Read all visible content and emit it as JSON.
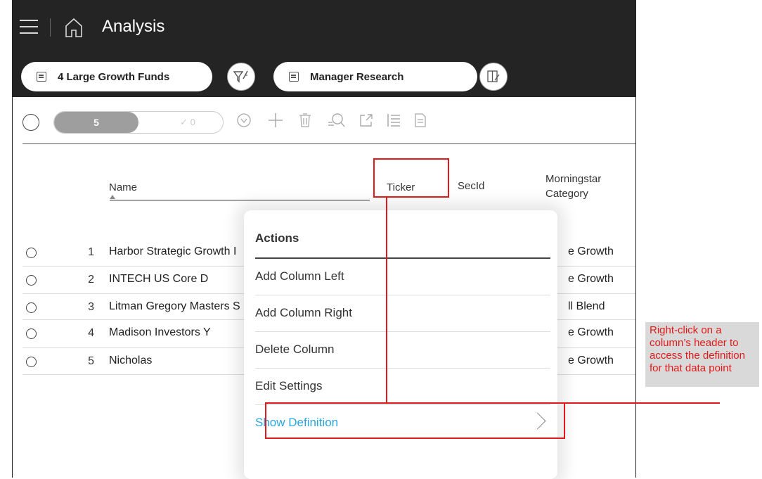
{
  "app": {
    "title": "Analysis"
  },
  "pills": {
    "list_label": "4 Large Growth Funds",
    "view_label": "Manager Research"
  },
  "toolbar": {
    "selected_count": "5",
    "checked_count": "✓ 0"
  },
  "columns": {
    "name": "Name",
    "ticker": "Ticker",
    "secid": "SecId",
    "category_line1": "Morningstar",
    "category_line2": "Category"
  },
  "rows": [
    {
      "num": "1",
      "name": "Harbor Strategic Growth I",
      "category": "e Growth"
    },
    {
      "num": "2",
      "name": "INTECH US Core D",
      "category": "e Growth"
    },
    {
      "num": "3",
      "name": "Litman Gregory Masters S",
      "category": "ll Blend"
    },
    {
      "num": "4",
      "name": "Madison Investors Y",
      "category": "e Growth"
    },
    {
      "num": "5",
      "name": "Nicholas",
      "category": "e Growth"
    }
  ],
  "context_menu": {
    "header": "Actions",
    "items": [
      "Add Column Left",
      "Add Column Right",
      "Delete Column",
      "Edit Settings",
      "Show Definition"
    ]
  },
  "annotation": {
    "text": "Right-click on a column’s header to access the definition for that data point"
  },
  "colors": {
    "accent_red": "#e01a1a",
    "link_blue": "#2aa6dc",
    "topbar": "#242424"
  },
  "icons": [
    "menu-icon",
    "home-icon",
    "list-icon",
    "filter-icon",
    "columns-icon",
    "chevron-down-icon",
    "add-icon",
    "trash-icon",
    "search-icon",
    "export-icon",
    "list-view-icon",
    "document-icon",
    "chevron-right-icon"
  ]
}
